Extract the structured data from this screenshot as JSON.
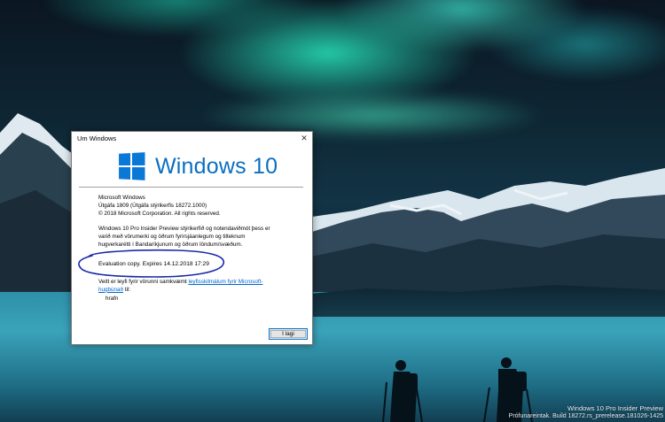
{
  "dialog": {
    "title": "Um Windows",
    "close_symbol": "✕",
    "logo_text": "Windows 10",
    "logo_icon": "windows-logo-icon",
    "product": "Microsoft Windows",
    "version": "Útgáfa 1809 (Útgáfa stýrikerfis 18272.1000)",
    "copyright": "© 2018 Microsoft Corporation. All rights reserved.",
    "description": "Windows 10 Pro Insider Preview stýrikerfið og notendaviðmót þess er varið með vörumerki og öðrum fyrirsjáanlegum og tilteknum hugverkarétti í Bandaríkjunum og öðrum löndum/svæðum.",
    "evaluation": "Evaluation copy. Expires 14.12.2018 17:29",
    "license_prefix": "Veitt er leyfi fyrir vörunni samkvæmt ",
    "license_link": "leyfisskilmálum fyrir Microsoft-hugbúnað",
    "license_suffix": " til:",
    "licensed_to": "hrafn",
    "ok_label": "Í lagi"
  },
  "watermark": {
    "line1": "Windows 10 Pro Insider Preview",
    "line2": "Prófunareintak. Build 18272.rs_prerelease.181026-1425"
  },
  "colors": {
    "accent": "#0a78d7",
    "link": "#0066cc",
    "annotation": "#1a2aa8"
  }
}
